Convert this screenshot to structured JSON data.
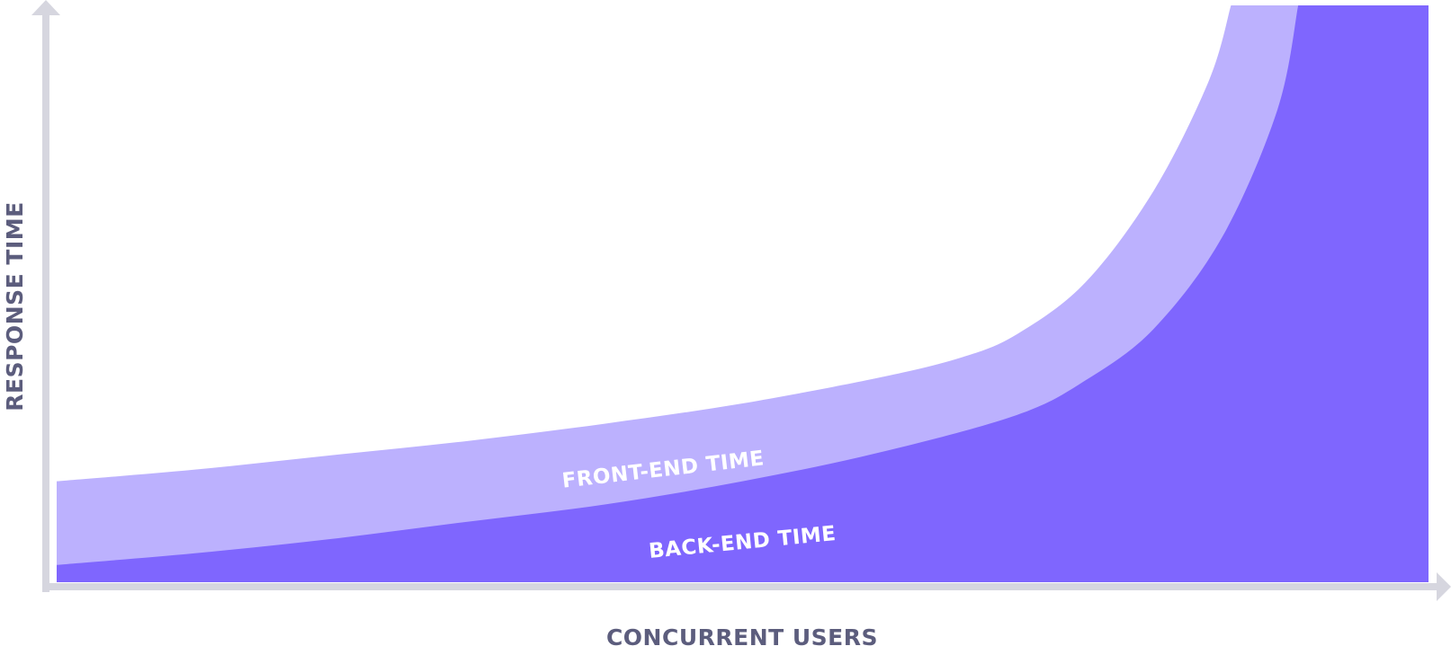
{
  "chart_data": {
    "type": "area",
    "stacked": true,
    "title": "",
    "xlabel": "CONCURRENT USERS",
    "ylabel": "RESPONSE TIME",
    "x_tick_labels": false,
    "y_tick_labels": false,
    "grid": false,
    "legend": "none (labels placed inside bands)",
    "series": [
      {
        "name": "BACK-END TIME",
        "color": "#7f66fe",
        "values": [
          {
            "x": 0.0,
            "y": 0.03
          },
          {
            "x": 0.1,
            "y": 0.05
          },
          {
            "x": 0.2,
            "y": 0.075
          },
          {
            "x": 0.3,
            "y": 0.105
          },
          {
            "x": 0.4,
            "y": 0.135
          },
          {
            "x": 0.5,
            "y": 0.175
          },
          {
            "x": 0.6,
            "y": 0.225
          },
          {
            "x": 0.7,
            "y": 0.29
          },
          {
            "x": 0.75,
            "y": 0.35
          },
          {
            "x": 0.8,
            "y": 0.44
          },
          {
            "x": 0.85,
            "y": 0.6
          },
          {
            "x": 0.89,
            "y": 0.82
          },
          {
            "x": 0.905,
            "y": 1.0
          },
          {
            "x": 1.0,
            "y": 1.0
          }
        ]
      },
      {
        "name": "FRONT-END TIME",
        "color": "#bcb1fe",
        "values": [
          {
            "x": 0.0,
            "y": 0.175
          },
          {
            "x": 0.1,
            "y": 0.195
          },
          {
            "x": 0.2,
            "y": 0.22
          },
          {
            "x": 0.3,
            "y": 0.245
          },
          {
            "x": 0.4,
            "y": 0.275
          },
          {
            "x": 0.5,
            "y": 0.31
          },
          {
            "x": 0.6,
            "y": 0.355
          },
          {
            "x": 0.66,
            "y": 0.39
          },
          {
            "x": 0.7,
            "y": 0.43
          },
          {
            "x": 0.75,
            "y": 0.52
          },
          {
            "x": 0.8,
            "y": 0.68
          },
          {
            "x": 0.84,
            "y": 0.87
          },
          {
            "x": 0.856,
            "y": 1.0
          },
          {
            "x": 1.0,
            "y": 1.0
          }
        ]
      }
    ],
    "xlim": [
      0,
      1
    ],
    "ylim": [
      0,
      1
    ]
  },
  "colors": {
    "axis": "#d6d6df",
    "axis_title": "#5c5d7d",
    "band_label": "#ffffff",
    "back_end": "#7f66fe",
    "front_end": "#bcb1fe"
  }
}
